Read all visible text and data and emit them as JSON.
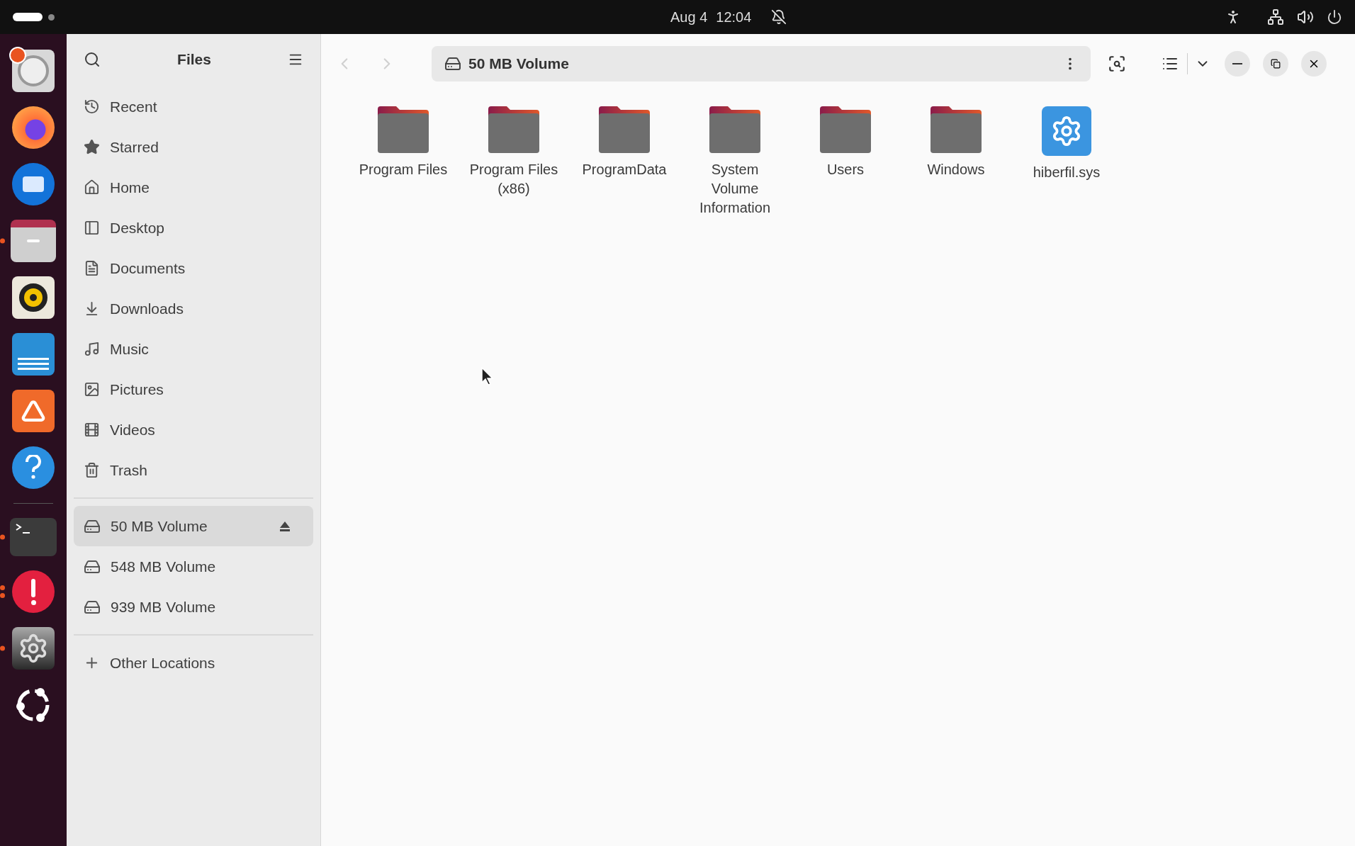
{
  "top_bar": {
    "date": "Aug 4",
    "time": "12:04",
    "notifications_muted": true
  },
  "dock": [
    {
      "kind": "disks",
      "running": false,
      "multiple_windows": false
    },
    {
      "kind": "firefox",
      "running": false,
      "multiple_windows": false
    },
    {
      "kind": "thunderbird",
      "running": false,
      "multiple_windows": false
    },
    {
      "kind": "files",
      "running": true,
      "multiple_windows": false
    },
    {
      "kind": "rhythmbox",
      "running": false,
      "multiple_windows": false
    },
    {
      "kind": "writer",
      "running": false,
      "multiple_windows": false
    },
    {
      "kind": "appcenter",
      "running": false,
      "multiple_windows": false
    },
    {
      "kind": "help",
      "running": false,
      "multiple_windows": false
    },
    {
      "kind": "separator",
      "running": false,
      "multiple_windows": false
    },
    {
      "kind": "terminal",
      "running": true,
      "multiple_windows": false
    },
    {
      "kind": "error",
      "running": true,
      "multiple_windows": true
    },
    {
      "kind": "settings",
      "running": true,
      "multiple_windows": false
    },
    {
      "kind": "apps",
      "running": false,
      "multiple_windows": false
    }
  ],
  "sidebar": {
    "title": "Files",
    "places": [
      {
        "kind": "recent",
        "label": "Recent"
      },
      {
        "kind": "starred",
        "label": "Starred"
      },
      {
        "kind": "home",
        "label": "Home"
      },
      {
        "kind": "desktop",
        "label": "Desktop"
      },
      {
        "kind": "documents",
        "label": "Documents"
      },
      {
        "kind": "downloads",
        "label": "Downloads"
      },
      {
        "kind": "music",
        "label": "Music"
      },
      {
        "kind": "pictures",
        "label": "Pictures"
      },
      {
        "kind": "videos",
        "label": "Videos"
      },
      {
        "kind": "trash",
        "label": "Trash"
      }
    ],
    "volumes": [
      {
        "label": "50 MB Volume",
        "selected": true,
        "ejectable": true
      },
      {
        "label": "548 MB Volume",
        "selected": false,
        "ejectable": false
      },
      {
        "label": "939 MB Volume",
        "selected": false,
        "ejectable": false
      }
    ],
    "other": {
      "label": "Other Locations"
    }
  },
  "header": {
    "back_disabled": true,
    "forward_disabled": true,
    "path": "50 MB Volume"
  },
  "files": [
    {
      "kind": "folder",
      "name": "Program Files"
    },
    {
      "kind": "folder",
      "name": "Program Files (x86)"
    },
    {
      "kind": "folder",
      "name": "ProgramData"
    },
    {
      "kind": "folder",
      "name": "System Volume Information"
    },
    {
      "kind": "folder",
      "name": "Users"
    },
    {
      "kind": "folder",
      "name": "Windows"
    },
    {
      "kind": "system",
      "name": "hiberfil.sys"
    }
  ]
}
